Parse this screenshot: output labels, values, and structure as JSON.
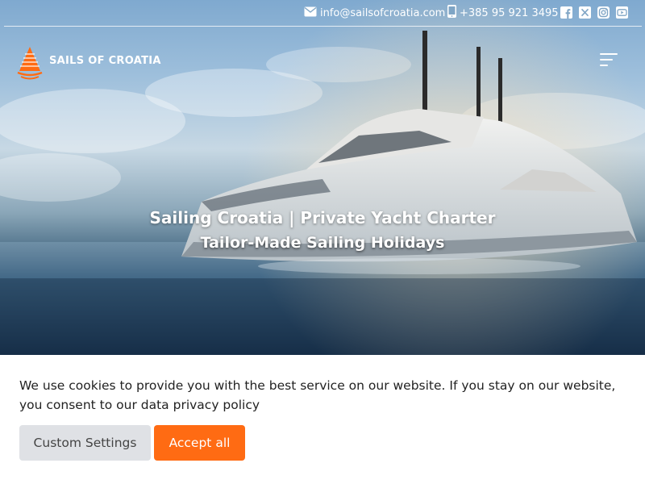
{
  "colors": {
    "accent": "#ff6b13",
    "custom_button_bg": "#dfe1e5",
    "text_white": "#ffffff"
  },
  "topbar": {
    "email": {
      "icon": "envelope-icon",
      "text": "info@sailsofcroatia.com"
    },
    "phone": {
      "icon": "mobile-phone-icon",
      "text": "+385 95 921 3495"
    },
    "social": [
      "facebook-icon",
      "x-twitter-icon",
      "instagram-icon",
      "youtube-icon"
    ]
  },
  "header": {
    "logo_text": "SAILS OF CROATIA",
    "menu_icon": "hamburger-menu-icon"
  },
  "hero": {
    "title": "Sailing Croatia | Private Yacht Charter",
    "subtitle": "Tailor-Made Sailing Holidays"
  },
  "cookie_banner": {
    "message": "We use cookies to provide you with the best service on our website. If you stay on our website, you consent to our data privacy policy",
    "custom_label": "Custom Settings",
    "accept_label": "Accept all"
  }
}
